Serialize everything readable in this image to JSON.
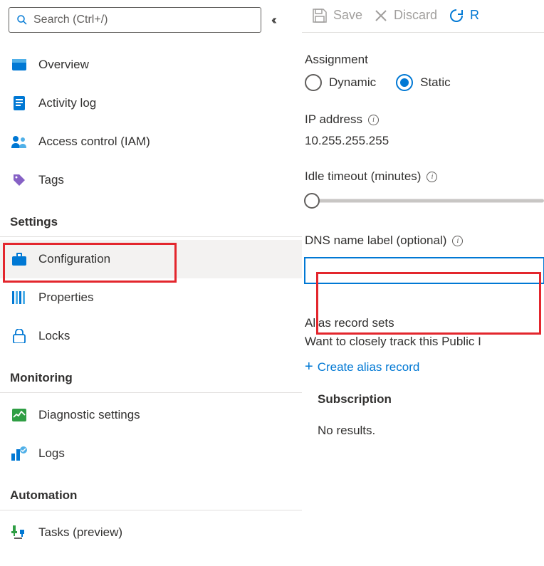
{
  "search": {
    "placeholder": "Search (Ctrl+/)"
  },
  "collapse_glyph": "‹‹",
  "nav": {
    "overview": "Overview",
    "activity_log": "Activity log",
    "access_control": "Access control (IAM)",
    "tags": "Tags"
  },
  "sections": {
    "settings": {
      "header": "Settings",
      "items": {
        "configuration": "Configuration",
        "properties": "Properties",
        "locks": "Locks"
      }
    },
    "monitoring": {
      "header": "Monitoring",
      "items": {
        "diagnostic": "Diagnostic settings",
        "logs": "Logs"
      }
    },
    "automation": {
      "header": "Automation",
      "items": {
        "tasks": "Tasks (preview)"
      }
    }
  },
  "toolbar": {
    "save": "Save",
    "discard": "Discard",
    "refresh": "R"
  },
  "form": {
    "assignment": {
      "label": "Assignment",
      "dynamic": "Dynamic",
      "static": "Static",
      "selected": "static"
    },
    "ip": {
      "label": "IP address",
      "value": "10.255.255.255"
    },
    "idle": {
      "label": "Idle timeout (minutes)"
    },
    "dns": {
      "label": "DNS name label (optional)",
      "value": ""
    },
    "alias": {
      "header": "Alias record sets",
      "desc": "Want to closely track this Public I",
      "create": "Create alias record"
    },
    "subscription": {
      "header": "Subscription",
      "no_results": "No results."
    }
  }
}
